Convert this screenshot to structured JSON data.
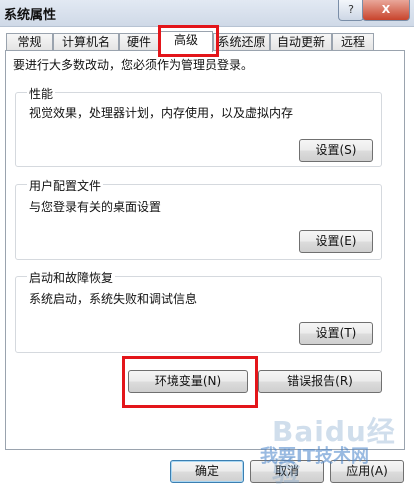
{
  "window": {
    "title": "系统属性",
    "help_label": "?",
    "close_label": "X"
  },
  "tabs": [
    {
      "label": "常规",
      "active": false
    },
    {
      "label": "计算机名",
      "active": false
    },
    {
      "label": "硬件",
      "active": false
    },
    {
      "label": "高级",
      "active": true
    },
    {
      "label": "系统还原",
      "active": false
    },
    {
      "label": "自动更新",
      "active": false
    },
    {
      "label": "远程",
      "active": false
    }
  ],
  "advanced": {
    "intro": "要进行大多数改动，您必须作为管理员登录。",
    "performance": {
      "title": "性能",
      "desc": "视觉效果，处理器计划，内存使用，以及虚拟内存",
      "button": "设置(S)"
    },
    "user_profiles": {
      "title": "用户配置文件",
      "desc": "与您登录有关的桌面设置",
      "button": "设置(E)"
    },
    "startup_recovery": {
      "title": "启动和故障恢复",
      "desc": "系统启动，系统失败和调试信息",
      "button": "设置(T)"
    },
    "env_vars_button": "环境变量(N)",
    "error_report_button": "错误报告(R)"
  },
  "footer": {
    "ok": "确定",
    "cancel": "取消",
    "apply": "应用(A)"
  },
  "watermark": {
    "main": "Baidu经验",
    "sub": "我要IT技术网"
  },
  "colors": {
    "highlight": "#e3151a",
    "titlebar": "#d6deea"
  }
}
